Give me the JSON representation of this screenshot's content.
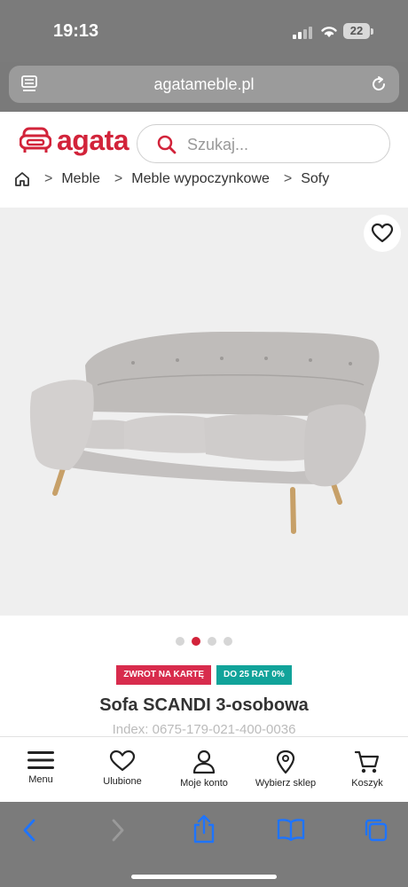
{
  "status": {
    "time": "19:13",
    "battery": "22"
  },
  "browser": {
    "url": "agatameble.pl",
    "icons": [
      "reader-icon",
      "reload-icon"
    ]
  },
  "header": {
    "logo": "agata",
    "search_placeholder": "Szukaj..."
  },
  "breadcrumb": {
    "items": [
      "Meble",
      "Meble wypoczynkowe",
      "Sofy"
    ]
  },
  "gallery": {
    "image_count": 4,
    "active_index": 1
  },
  "badges": {
    "return": "ZWROT NA KARTĘ",
    "installments": "DO 25 RAT 0%"
  },
  "product": {
    "title": "Sofa SCANDI 3-osobowa",
    "index": "Index: 0675-179-021-400-0036"
  },
  "bottom_nav": {
    "items": [
      "Menu",
      "Ulubione",
      "Moje konto",
      "Wybierz sklep",
      "Koszyk"
    ]
  },
  "colors": {
    "brand": "#d2233a",
    "badge_red": "#d82c4d",
    "badge_teal": "#11a39a"
  }
}
